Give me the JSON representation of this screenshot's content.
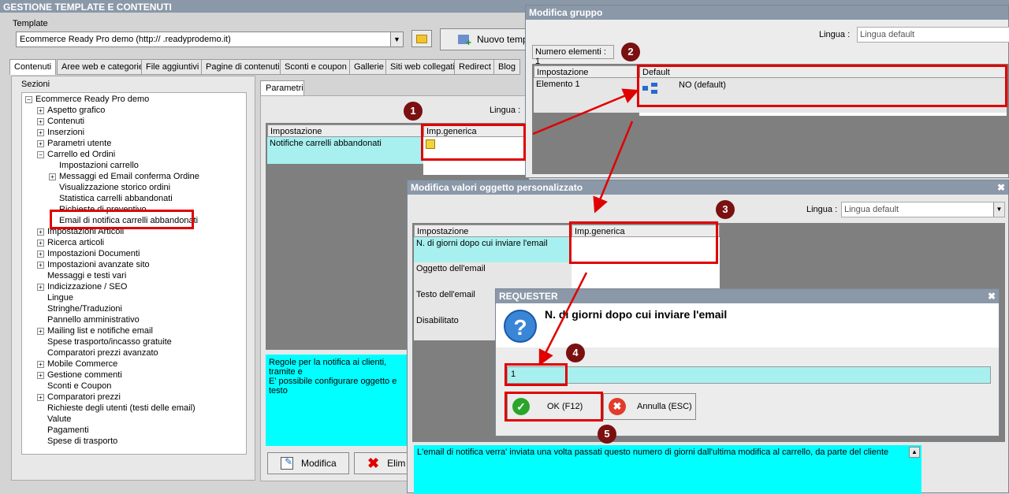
{
  "main": {
    "title": "GESTIONE TEMPLATE E CONTENUTI",
    "template_label": "Template",
    "template_select": "Ecommerce Ready Pro demo      (http://        .readyprodemo.it)",
    "new_template_label": "Nuovo temp",
    "tabs": [
      "Contenuti",
      "Aree web e categorie",
      "File aggiuntivi",
      "Pagine di contenuti",
      "Sconti e coupon",
      "Gallerie",
      "Siti web collegati",
      "Redirect",
      "Blog"
    ],
    "sections_label": "Sezioni",
    "tree": [
      {
        "label": "Ecommerce Ready Pro demo",
        "level": 0,
        "exp": "minus"
      },
      {
        "label": "Aspetto grafico",
        "level": 1,
        "exp": "plus"
      },
      {
        "label": "Contenuti",
        "level": 1,
        "exp": "plus"
      },
      {
        "label": "Inserzioni",
        "level": 1,
        "exp": "plus"
      },
      {
        "label": "Parametri utente",
        "level": 1,
        "exp": "plus"
      },
      {
        "label": "Carrello ed Ordini",
        "level": 1,
        "exp": "minus"
      },
      {
        "label": "Impostazioni carrello",
        "level": 2,
        "exp": ""
      },
      {
        "label": "Messaggi ed Email conferma Ordine",
        "level": 2,
        "exp": "plus"
      },
      {
        "label": "Visualizzazione storico ordini",
        "level": 2,
        "exp": ""
      },
      {
        "label": "Statistica carrelli abbandonati",
        "level": 2,
        "exp": ""
      },
      {
        "label": "Richieste di preventivo",
        "level": 2,
        "exp": ""
      },
      {
        "label": "Email di notifica carrelli abbandonati",
        "level": 2,
        "exp": ""
      },
      {
        "label": "Impostazioni Articoli",
        "level": 1,
        "exp": "plus"
      },
      {
        "label": "Ricerca articoli",
        "level": 1,
        "exp": "plus"
      },
      {
        "label": "Impostazioni Documenti",
        "level": 1,
        "exp": "plus"
      },
      {
        "label": "Impostazioni avanzate sito",
        "level": 1,
        "exp": "plus"
      },
      {
        "label": "Messaggi e testi vari",
        "level": 1,
        "exp": ""
      },
      {
        "label": "Indicizzazione / SEO",
        "level": 1,
        "exp": "plus"
      },
      {
        "label": "Lingue",
        "level": 1,
        "exp": ""
      },
      {
        "label": "Stringhe/Traduzioni",
        "level": 1,
        "exp": ""
      },
      {
        "label": "Pannello amministrativo",
        "level": 1,
        "exp": ""
      },
      {
        "label": "Mailing list e notifiche email",
        "level": 1,
        "exp": "plus"
      },
      {
        "label": "Spese trasporto/incasso gratuite",
        "level": 1,
        "exp": ""
      },
      {
        "label": "Comparatori prezzi avanzato",
        "level": 1,
        "exp": ""
      },
      {
        "label": "Mobile Commerce",
        "level": 1,
        "exp": "plus"
      },
      {
        "label": "Gestione commenti",
        "level": 1,
        "exp": "plus"
      },
      {
        "label": "Sconti e Coupon",
        "level": 1,
        "exp": ""
      },
      {
        "label": "Comparatori prezzi",
        "level": 1,
        "exp": "plus"
      },
      {
        "label": "Richieste degli utenti (testi delle email)",
        "level": 1,
        "exp": ""
      },
      {
        "label": "Valute",
        "level": 1,
        "exp": ""
      },
      {
        "label": "Pagamenti",
        "level": 1,
        "exp": ""
      },
      {
        "label": "Spese di trasporto",
        "level": 1,
        "exp": ""
      }
    ],
    "params_tab": "Parametri",
    "lingua_label": "Lingua :",
    "col_setting": "Impostazione",
    "col_generic": "Imp.generica",
    "row_setting": "Notifiche carrelli abbandonati",
    "description": "Regole per la notifica ai clienti, tramite e",
    "description2": "E' possibile configurare oggetto e testo",
    "modify_label": "Modifica",
    "delete_label": "Elim"
  },
  "group_win": {
    "title": "Modifica gruppo",
    "lingua_label": "Lingua :",
    "lingua_value": "Lingua default",
    "count_label": "Numero elementi : 1",
    "col_setting": "Impostazione",
    "col_default": "Default",
    "row_setting": "Elemento 1",
    "row_value": "NO (default)"
  },
  "custom_win": {
    "title": "Modifica valori oggetto personalizzato",
    "lingua_label": "Lingua :",
    "lingua_value": "Lingua default",
    "col_setting": "Impostazione",
    "col_generic": "Imp.generica",
    "rows": [
      "N. di giorni dopo cui inviare l'email",
      "Oggetto dell'email",
      "Testo dell'email",
      "Disabilitato"
    ],
    "description": "L'email di notifica verra' inviata una volta passati questo numero di giorni dall'ultima modifica al carrello, da parte del cliente"
  },
  "requester": {
    "title": "REQUESTER",
    "question": "N. di giorni dopo cui inviare l'email",
    "input_value": "1",
    "ok_label": "OK (F12)",
    "cancel_label": "Annulla (ESC)"
  },
  "markers": [
    "1",
    "2",
    "3",
    "4",
    "5"
  ],
  "colors": {
    "titlebar": "#8a98a8",
    "highlight": "#e00000",
    "cyan": "#00ffff"
  }
}
